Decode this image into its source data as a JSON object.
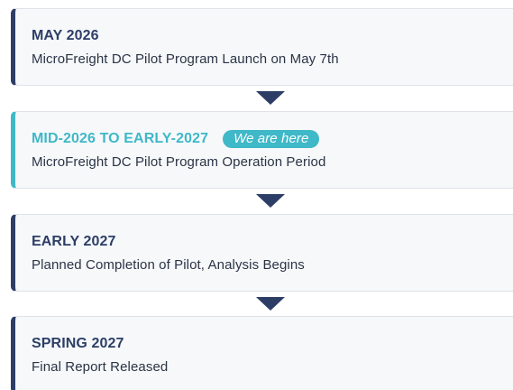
{
  "milestones": [
    {
      "title": "MAY 2026",
      "description": "MicroFreight DC Pilot Program Launch on May 7th"
    },
    {
      "title": "MID-2026 TO EARLY-2027",
      "badge": "We are here",
      "description": "MicroFreight DC Pilot Program Operation Period"
    },
    {
      "title": "EARLY 2027",
      "description": "Planned Completion of Pilot, Analysis Begins"
    },
    {
      "title": "SPRING 2027",
      "description": "Final Report Released"
    }
  ],
  "colors": {
    "accent_navy": "#2d3e66",
    "accent_teal": "#3fb8c8",
    "card_background": "#f6f8fa"
  },
  "icons": {
    "connector": "down-triangle-icon"
  }
}
